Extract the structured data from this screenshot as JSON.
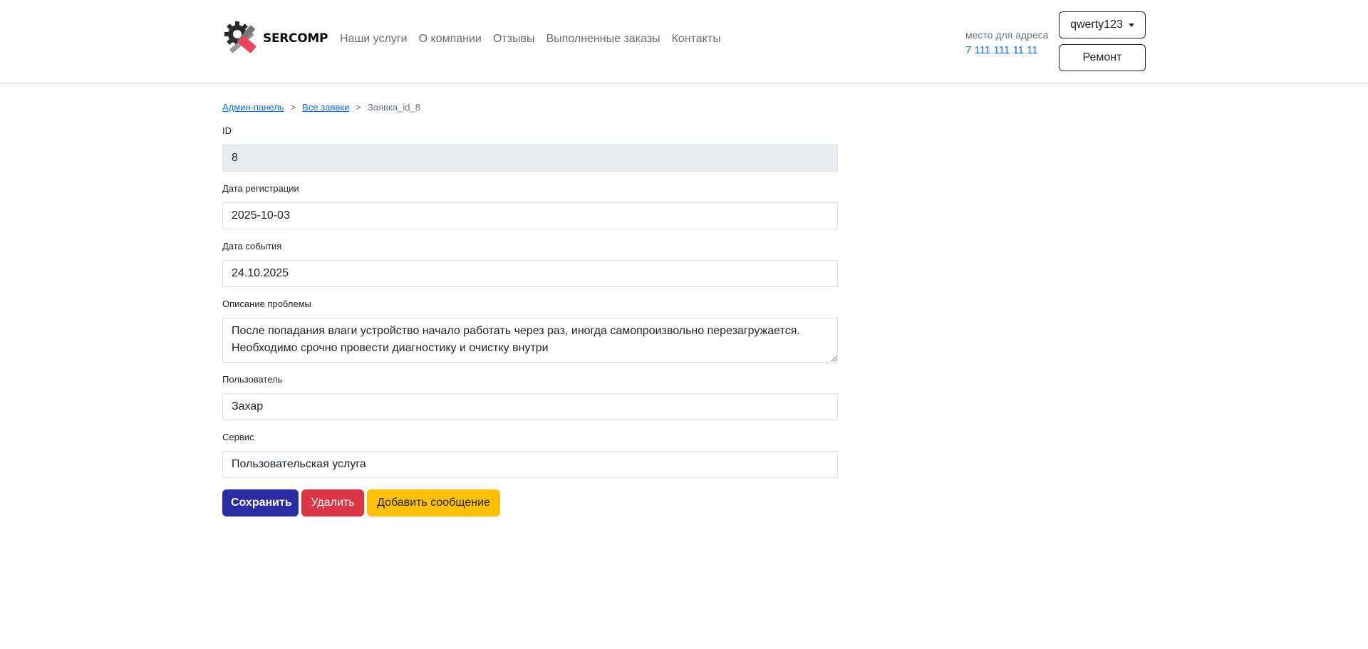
{
  "brand": {
    "name": "SERCOMP"
  },
  "nav": {
    "links": [
      "Наши услуги",
      "О компании",
      "Отзывы",
      "Выполненные заказы",
      "Контакты"
    ]
  },
  "contact": {
    "address": "место для адреса",
    "phone": "7 111 111 11 11"
  },
  "user_menu": {
    "username": "qwerty123"
  },
  "repair_button": "Ремонт",
  "breadcrumb": {
    "admin": "Админ-панель",
    "all": "Все заявки",
    "current": "Заявка_id_8",
    "separator": ">"
  },
  "form": {
    "id_label": "ID",
    "id_value": "8",
    "reg_date_label": "Дата регистрации",
    "reg_date_value": "2025-10-03",
    "event_date_label": "Дата события",
    "event_date_value": "24.10.2025",
    "description_label": "Описание проблемы",
    "description_value": "После попадания влаги устройство начало работать через раз, иногда самопроизвольно перезагружается. Необходимо срочно провести диагностику и очистку внутри",
    "user_label": "Пользователь",
    "user_value": "Захар",
    "service_label": "Сервис",
    "service_value": "Пользовательская услуга"
  },
  "actions": {
    "save": "Сохранить",
    "delete": "Удалить",
    "add_message": "Добавить сообщение"
  },
  "colors": {
    "primary": "#2a2aa3",
    "danger": "#dc3545",
    "warning": "#ffc107",
    "link": "#0d6efd",
    "logo_accent": "#e8455a"
  }
}
